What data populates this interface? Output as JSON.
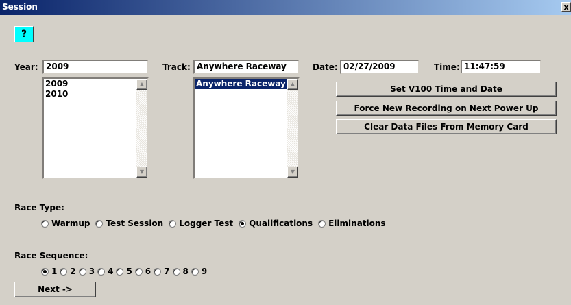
{
  "window": {
    "title": "Session",
    "close_label": "x"
  },
  "help_button": {
    "glyph": "?"
  },
  "year": {
    "label": "Year:",
    "value": "2009",
    "options": [
      "2009",
      "2010"
    ]
  },
  "track": {
    "label": "Track:",
    "value": "Anywhere Raceway",
    "options": [
      "Anywhere Raceway"
    ]
  },
  "date": {
    "label": "Date:",
    "value": "02/27/2009"
  },
  "time": {
    "label": "Time:",
    "value": "11:47:59"
  },
  "actions": {
    "set_time": "Set V100 Time and Date",
    "force_new": "Force New Recording on Next Power Up",
    "clear_data": "Clear Data Files From Memory Card"
  },
  "race_type": {
    "label": "Race Type:",
    "options": [
      "Warmup",
      "Test Session",
      "Logger Test",
      "Qualifications",
      "Eliminations"
    ],
    "selected": "Qualifications"
  },
  "race_sequence": {
    "label": "Race Sequence:",
    "options": [
      "1",
      "2",
      "3",
      "4",
      "5",
      "6",
      "7",
      "8",
      "9"
    ],
    "selected": "1"
  },
  "next_button": "Next ->",
  "icons": {
    "help": "question-icon",
    "scroll_up": "arrow-up-icon",
    "scroll_down": "arrow-down-icon"
  }
}
